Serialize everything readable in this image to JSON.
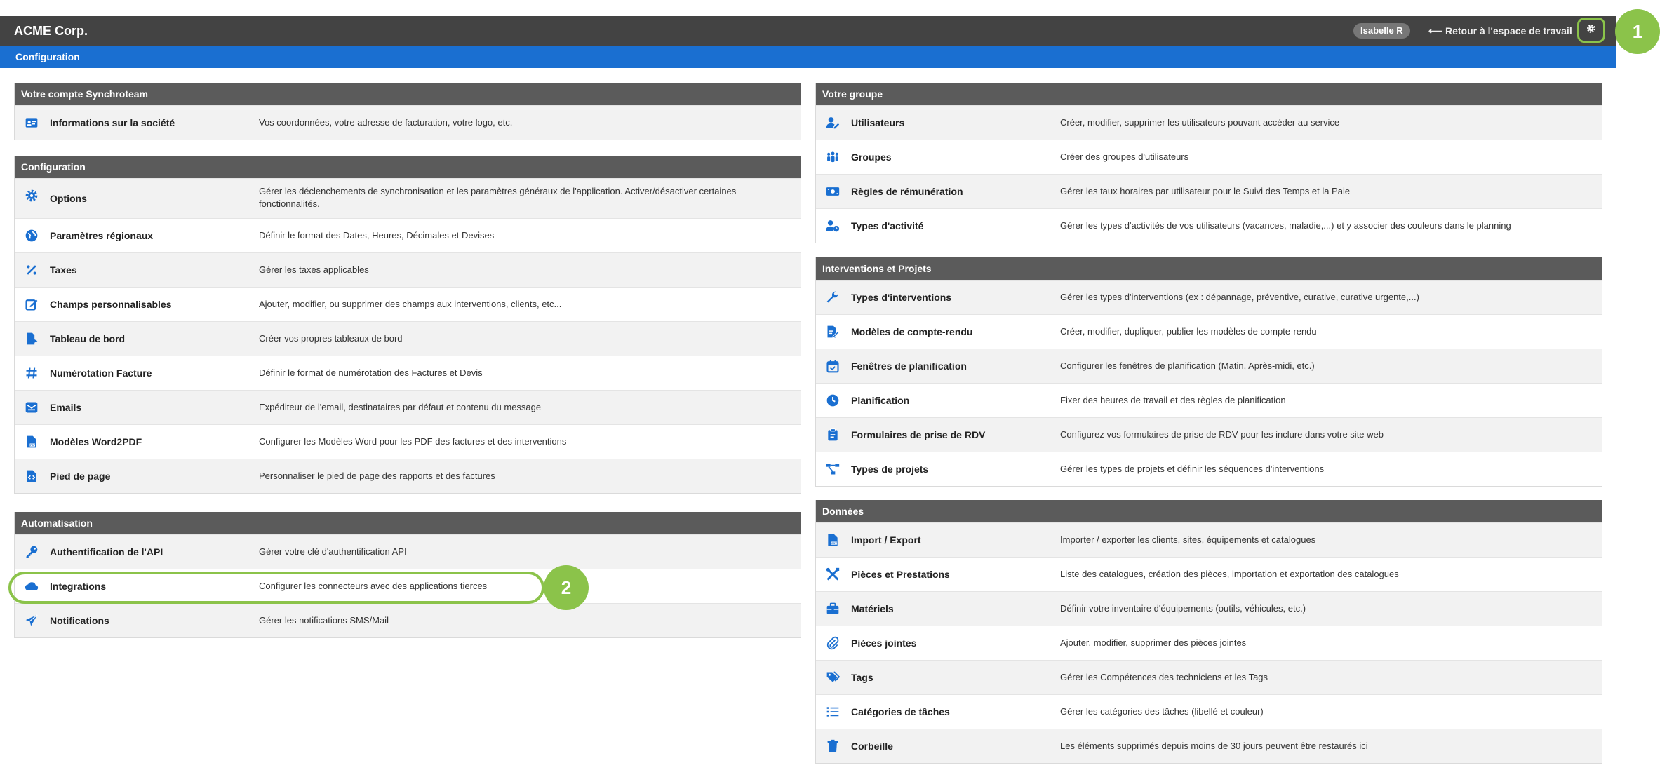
{
  "topbar": {
    "brand": "ACME Corp.",
    "user": "Isabelle R",
    "back_link": "⟵ Retour à l'espace de travail",
    "settings_icon": "gear-icon"
  },
  "subbar": {
    "title": "Configuration"
  },
  "callouts": [
    "1",
    "2"
  ],
  "colors": {
    "accent": "#1a6fd1",
    "highlight": "#8bc34a",
    "topbar": "#434343",
    "panel_header": "#5b5b5b"
  },
  "left": {
    "account": {
      "title": "Votre compte Synchroteam",
      "items": [
        {
          "icon": "id-card-icon",
          "label": "Informations sur la société",
          "desc": "Vos coordonnées, votre adresse de facturation, votre logo, etc."
        }
      ]
    },
    "config": {
      "title": "Configuration",
      "items": [
        {
          "icon": "gear-icon",
          "label": "Options",
          "desc": "Gérer les déclenchements de synchronisation et les paramètres généraux de l'application. Activer/désactiver certaines fonctionnalités."
        },
        {
          "icon": "globe-icon",
          "label": "Paramètres régionaux",
          "desc": "Définir le format des Dates, Heures, Décimales et Devises"
        },
        {
          "icon": "percent-icon",
          "label": "Taxes",
          "desc": "Gérer les taxes applicables"
        },
        {
          "icon": "edit-icon",
          "label": "Champs personnalisables",
          "desc": "Ajouter, modifier, ou supprimer des champs aux interventions, clients, etc..."
        },
        {
          "icon": "dashboard-icon",
          "label": "Tableau de bord",
          "desc": "Créer vos propres tableaux de bord"
        },
        {
          "icon": "hash-icon",
          "label": "Numérotation Facture",
          "desc": "Définir le format de numérotation des Factures et Devis"
        },
        {
          "icon": "email-icon",
          "label": "Emails",
          "desc": "Expéditeur de l'email, destinataires par défaut et contenu du message"
        },
        {
          "icon": "pdf-file-icon",
          "label": "Modèles Word2PDF",
          "desc": "Configurer les Modèles Word pour les PDF des factures et des interventions"
        },
        {
          "icon": "code-file-icon",
          "label": "Pied de page",
          "desc": "Personnaliser le pied de page des rapports et des factures"
        }
      ]
    },
    "automation": {
      "title": "Automatisation",
      "items": [
        {
          "icon": "key-icon",
          "label": "Authentification de l'API",
          "desc": "Gérer votre clé d'authentification API"
        },
        {
          "icon": "cloud-icon",
          "label": "Integrations",
          "desc": "Configurer les connecteurs avec des applications tierces"
        },
        {
          "icon": "send-icon",
          "label": "Notifications",
          "desc": "Gérer les notifications SMS/Mail"
        }
      ]
    }
  },
  "right": {
    "group": {
      "title": "Votre groupe",
      "items": [
        {
          "icon": "user-edit-icon",
          "label": "Utilisateurs",
          "desc": "Créer, modifier, supprimer les utilisateurs pouvant accéder au service"
        },
        {
          "icon": "users-icon",
          "label": "Groupes",
          "desc": "Créer des groupes d'utilisateurs"
        },
        {
          "icon": "money-icon",
          "label": "Règles de rémunération",
          "desc": "Gérer les taux horaires par utilisateur pour le Suivi des Temps et la Paie"
        },
        {
          "icon": "user-clock-icon",
          "label": "Types d'activité",
          "desc": "Gérer les types d'activités de vos utilisateurs (vacances, maladie,...) et y associer des couleurs dans le planning"
        }
      ]
    },
    "interventions": {
      "title": "Interventions et Projets",
      "items": [
        {
          "icon": "wrench-icon",
          "label": "Types d'interventions",
          "desc": "Gérer les types d'interventions (ex : dépannage, préventive, curative, curative urgente,...)"
        },
        {
          "icon": "report-edit-icon",
          "label": "Modèles de compte-rendu",
          "desc": "Créer, modifier, dupliquer, publier les modèles de compte-rendu"
        },
        {
          "icon": "calendar-check-icon",
          "label": "Fenêtres de planification",
          "desc": "Configurer les fenêtres de planification (Matin, Après-midi, etc.)"
        },
        {
          "icon": "clock-icon",
          "label": "Planification",
          "desc": "Fixer des heures de travail et des règles de planification"
        },
        {
          "icon": "clipboard-icon",
          "label": "Formulaires de prise de RDV",
          "desc": "Configurez vos formulaires de prise de RDV pour les inclure dans votre site web"
        },
        {
          "icon": "project-diagram-icon",
          "label": "Types de projets",
          "desc": "Gérer les types de projets et définir les séquences d'interventions"
        }
      ]
    },
    "data": {
      "title": "Données",
      "items": [
        {
          "icon": "csv-file-icon",
          "label": "Import / Export",
          "desc": "Importer / exporter les clients, sites, équipements et catalogues"
        },
        {
          "icon": "tools-icon",
          "label": "Pièces et Prestations",
          "desc": "Liste des catalogues, création des pièces, importation et exportation des catalogues"
        },
        {
          "icon": "toolbox-icon",
          "label": "Matériels",
          "desc": "Définir votre inventaire d'équipements (outils, véhicules, etc.)"
        },
        {
          "icon": "paperclip-icon",
          "label": "Pièces jointes",
          "desc": "Ajouter, modifier, supprimer des pièces jointes"
        },
        {
          "icon": "tags-icon",
          "label": "Tags",
          "desc": "Gérer les Compétences des techniciens et les Tags"
        },
        {
          "icon": "list-icon",
          "label": "Catégories de tâches",
          "desc": "Gérer les catégories des tâches (libellé et couleur)"
        },
        {
          "icon": "trash-icon",
          "label": "Corbeille",
          "desc": "Les éléments supprimés depuis moins de 30 jours peuvent être restaurés ici"
        }
      ]
    }
  }
}
